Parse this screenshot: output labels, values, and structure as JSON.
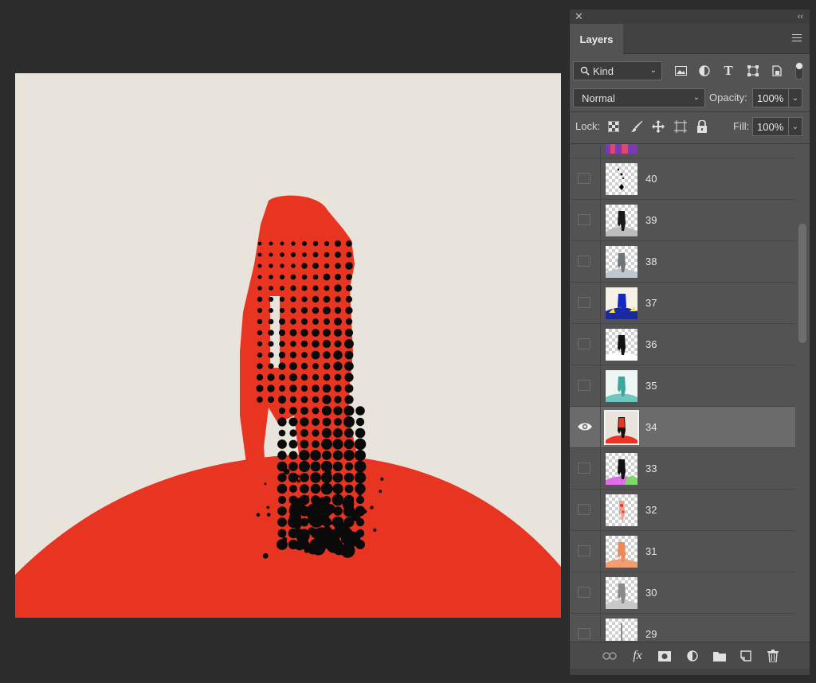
{
  "panel": {
    "close_glyph": "✕",
    "collapse_glyph": "‹‹",
    "tab_label": "Layers",
    "filter": {
      "kind_label": "Kind",
      "icons": [
        "image-filter-icon",
        "adjustment-filter-icon",
        "type-filter-icon",
        "shape-filter-icon",
        "smart-object-filter-icon"
      ]
    },
    "blend_mode": "Normal",
    "opacity_label": "Opacity:",
    "opacity_value": "100%",
    "lock_label": "Lock:",
    "fill_label": "Fill:",
    "fill_value": "100%",
    "layers": [
      {
        "name": "",
        "visible": false,
        "selected": false
      },
      {
        "name": "40",
        "visible": false,
        "selected": false
      },
      {
        "name": "39",
        "visible": false,
        "selected": false
      },
      {
        "name": "38",
        "visible": false,
        "selected": false
      },
      {
        "name": "37",
        "visible": false,
        "selected": false
      },
      {
        "name": "36",
        "visible": false,
        "selected": false
      },
      {
        "name": "35",
        "visible": false,
        "selected": false
      },
      {
        "name": "34",
        "visible": true,
        "selected": true
      },
      {
        "name": "33",
        "visible": false,
        "selected": false
      },
      {
        "name": "32",
        "visible": false,
        "selected": false
      },
      {
        "name": "31",
        "visible": false,
        "selected": false
      },
      {
        "name": "30",
        "visible": false,
        "selected": false
      },
      {
        "name": "29",
        "visible": false,
        "selected": false
      }
    ]
  },
  "colors": {
    "canvas_bg": "#e8e4dc",
    "hill_red": "#e83522",
    "figure_black": "#0a0a0a",
    "panel_bg": "#535353",
    "app_bg": "#2c2c2c"
  }
}
